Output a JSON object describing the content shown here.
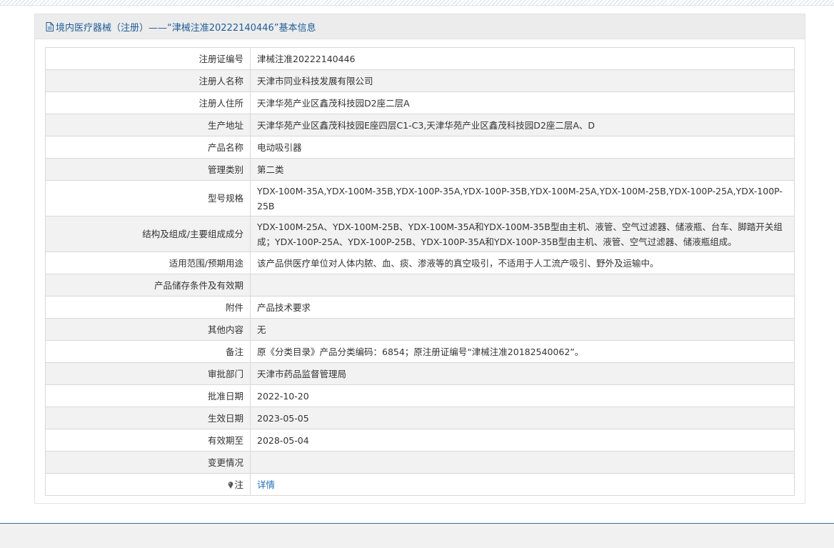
{
  "header": {
    "title": "境内医疗器械（注册）——“津械注准20222140446”基本信息"
  },
  "rows": [
    {
      "label": "注册证编号",
      "value": "津械注准20222140446"
    },
    {
      "label": "注册人名称",
      "value": "天津市同业科技发展有限公司"
    },
    {
      "label": "注册人住所",
      "value": "天津华苑产业区鑫茂科技园D2座二层A"
    },
    {
      "label": "生产地址",
      "value": "天津华苑产业区鑫茂科技园E座四层C1-C3,天津华苑产业区鑫茂科技园D2座二层A、D"
    },
    {
      "label": "产品名称",
      "value": "电动吸引器"
    },
    {
      "label": "管理类别",
      "value": "第二类"
    },
    {
      "label": "型号规格",
      "value": "YDX-100M-35A,YDX-100M-35B,YDX-100P-35A,YDX-100P-35B,YDX-100M-25A,YDX-100M-25B,YDX-100P-25A,YDX-100P-25B"
    },
    {
      "label": "结构及组成/主要组成成分",
      "value": "YDX-100M-25A、YDX-100M-25B、YDX-100M-35A和YDX-100M-35B型由主机、液管、空气过滤器、储液瓶、台车、脚踏开关组成；YDX-100P-25A、YDX-100P-25B、YDX-100P-35A和YDX-100P-35B型由主机、液管、空气过滤器、储液瓶组成。"
    },
    {
      "label": "适用范围/预期用途",
      "value": "该产品供医疗单位对人体内脓、血、痰、渗液等的真空吸引，不适用于人工流产吸引、野外及运输中。"
    },
    {
      "label": "产品储存条件及有效期",
      "value": ""
    },
    {
      "label": "附件",
      "value": "产品技术要求"
    },
    {
      "label": "其他内容",
      "value": "无"
    },
    {
      "label": "备注",
      "value": "原《分类目录》产品分类编码：6854；原注册证编号“津械注准20182540062”。"
    },
    {
      "label": "审批部门",
      "value": "天津市药品监督管理局"
    },
    {
      "label": "批准日期",
      "value": "2022-10-20"
    },
    {
      "label": "生效日期",
      "value": "2023-05-05"
    },
    {
      "label": "有效期至",
      "value": "2028-05-04"
    },
    {
      "label": "变更情况",
      "value": ""
    }
  ],
  "note": {
    "label": "注",
    "link": "详情",
    "icon": "pin-icon"
  },
  "colors": {
    "title": "#1f5d96",
    "link": "#1f6fb5",
    "row_alt": "#f2f2f2",
    "header_bg": "#ececec"
  }
}
